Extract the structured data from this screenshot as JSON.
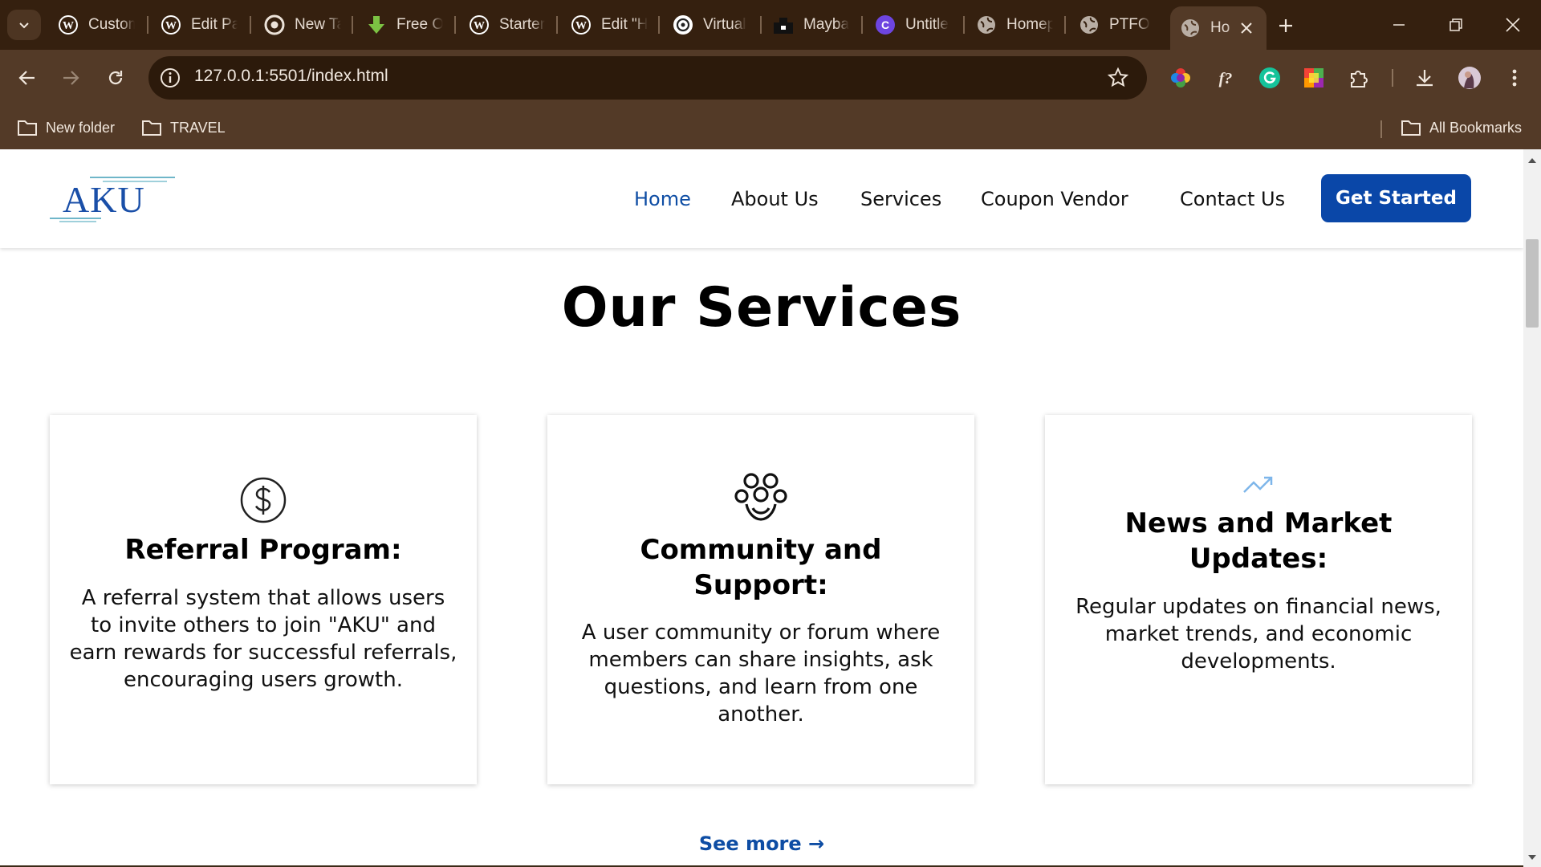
{
  "browser": {
    "tabs": [
      {
        "title": "Custom",
        "icon": "wordpress-icon"
      },
      {
        "title": "Edit Pa",
        "icon": "wordpress-icon"
      },
      {
        "title": "New Ta",
        "icon": "chrome-icon"
      },
      {
        "title": "Free O",
        "icon": "download-arrow-icon"
      },
      {
        "title": "Starter",
        "icon": "wordpress-icon"
      },
      {
        "title": "Edit \"H",
        "icon": "wordpress-icon"
      },
      {
        "title": "Virtual",
        "icon": "openai-icon"
      },
      {
        "title": "Mayba",
        "icon": "site-icon"
      },
      {
        "title": "Untitle",
        "icon": "canva-icon"
      },
      {
        "title": "Homep",
        "icon": "globe-icon"
      },
      {
        "title": "PTFO",
        "icon": "globe-icon"
      },
      {
        "title": "Ho",
        "icon": "globe-icon",
        "active": true
      }
    ],
    "url": "127.0.0.1:5501/index.html",
    "bookmarks": [
      {
        "label": "New folder"
      },
      {
        "label": "TRAVEL"
      }
    ],
    "all_bookmarks": "All Bookmarks",
    "accent": "#533a27"
  },
  "site": {
    "logo": "AKU",
    "nav": [
      {
        "label": "Home",
        "active": true
      },
      {
        "label": "About Us"
      },
      {
        "label": "Services"
      },
      {
        "label": "Coupon Vendor"
      },
      {
        "label": "Contact Us"
      }
    ],
    "cta": "Get Started",
    "brand_color": "#0a47a8"
  },
  "services": {
    "title": "Our Services",
    "cards": [
      {
        "icon": "dollar-icon",
        "title": "Referral Program:",
        "text": "A referral system that allows users to invite others to join \"AKU\" and earn rewards for successful referrals, encouraging users growth."
      },
      {
        "icon": "community-icon",
        "title": "Community and Support:",
        "text": "A user community or forum where members can share insights, ask questions, and learn from one another."
      },
      {
        "icon": "trending-up-icon",
        "title": "News and Market Updates:",
        "text": "Regular updates on financial news, market trends, and economic developments."
      }
    ],
    "see_more": "See more →"
  }
}
